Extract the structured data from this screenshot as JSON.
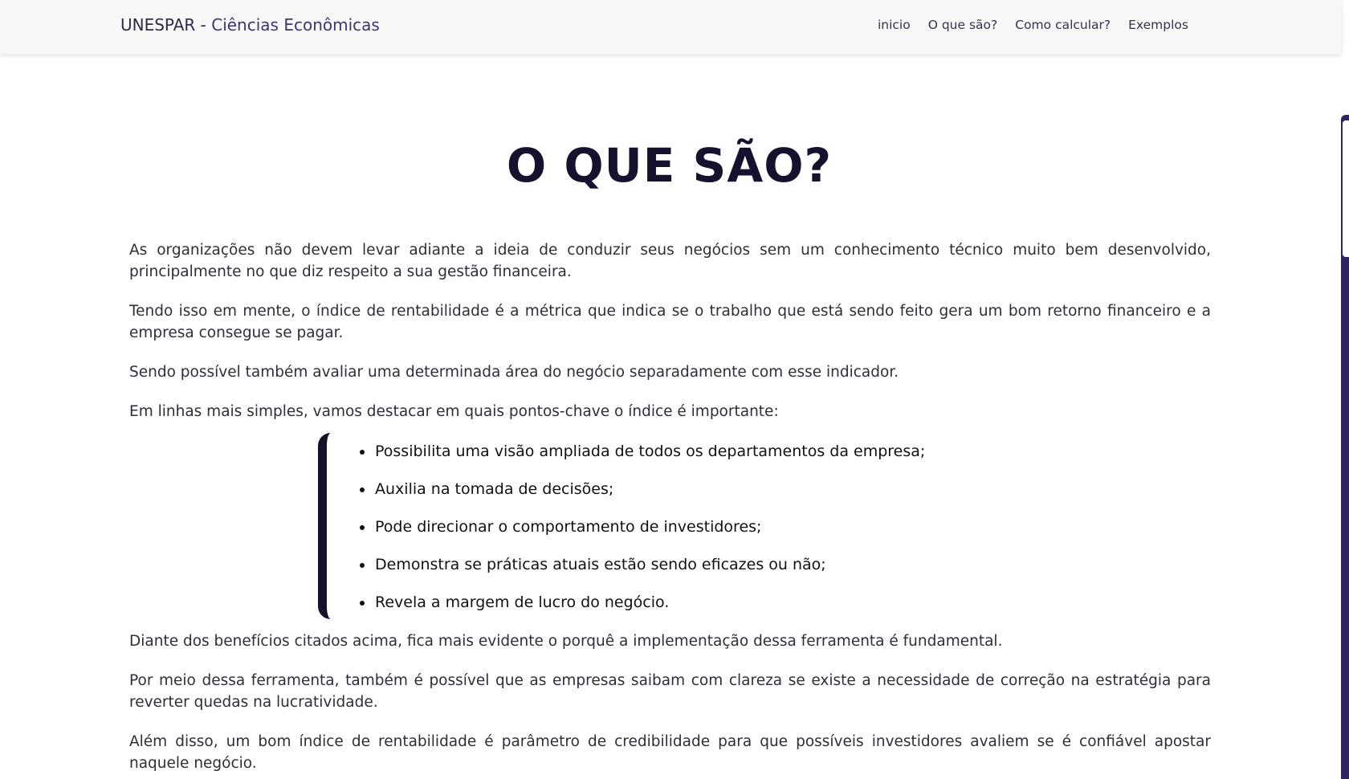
{
  "navbar": {
    "brand_prefix": "UNESPAR - ",
    "brand_suffix": "Ciências Econômicas",
    "links": [
      "inicio",
      "O que são?",
      "Como calcular?",
      "Exemplos"
    ]
  },
  "main": {
    "title": "O QUE SÃO?",
    "paragraphs": [
      "As organizações não devem levar adiante a ideia de conduzir seus negócios sem um conhecimento técnico muito bem desenvolvido, principalmente no que diz respeito a sua gestão financeira.",
      "Tendo isso em mente, o índice de rentabilidade é a métrica que indica se o trabalho que está sendo feito gera um bom retorno financeiro e a empresa consegue se pagar.",
      "Sendo possível também avaliar uma determinada área do negócio separadamente com esse indicador.",
      "Em linhas mais simples, vamos destacar em quais pontos-chave o índice é importante:"
    ],
    "bullets": [
      "Possibilita uma visão ampliada de todos os departamentos da empresa;",
      "Auxilia na tomada de decisões;",
      "Pode direcionar o comportamento de investidores;",
      "Demonstra se práticas atuais estão sendo eficazes ou não;",
      "Revela a margem de lucro do negócio."
    ],
    "after_paragraphs": [
      "Diante dos benefícios citados acima, fica mais evidente o porquê a implementação dessa ferramenta é fundamental.",
      "Por meio dessa ferramenta, também é possível que as empresas saibam com clareza se existe a necessidade de correção na estratégia para reverter quedas na lucratividade.",
      "Além disso, um bom índice de rentabilidade é parâmetro de credibilidade para que possíveis investidores avaliem se é confiável apostar naquele negócio."
    ]
  },
  "colors": {
    "navbar_bg": "#f8f8f9",
    "title": "#16122e",
    "accent": "#2e2560",
    "quote_bar": "#14112a"
  }
}
